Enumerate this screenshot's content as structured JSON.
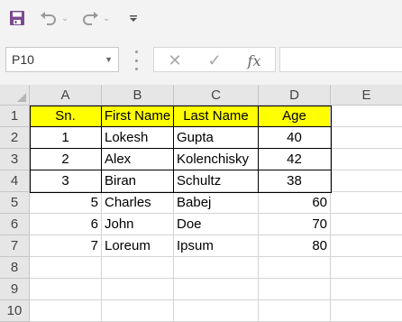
{
  "name_box": {
    "value": "P10"
  },
  "formula_bar": {
    "value": ""
  },
  "columns": [
    "A",
    "B",
    "C",
    "D",
    "E"
  ],
  "rows": [
    {
      "num": "1",
      "cells": [
        "Sn.",
        "First Name",
        "Last Name",
        "Age",
        ""
      ]
    },
    {
      "num": "2",
      "cells": [
        "1",
        "Lokesh",
        "Gupta",
        "40",
        ""
      ]
    },
    {
      "num": "3",
      "cells": [
        "2",
        "Alex",
        "Kolenchisky",
        "42",
        ""
      ]
    },
    {
      "num": "4",
      "cells": [
        "3",
        "Biran",
        "Schultz",
        "38",
        ""
      ]
    },
    {
      "num": "5",
      "cells": [
        "5",
        "Charles",
        "Babej",
        "60",
        ""
      ]
    },
    {
      "num": "6",
      "cells": [
        "6",
        "John",
        "Doe",
        "70",
        ""
      ]
    },
    {
      "num": "7",
      "cells": [
        "7",
        "Loreum",
        "Ipsum",
        "80",
        ""
      ]
    },
    {
      "num": "8",
      "cells": [
        "",
        "",
        "",
        "",
        ""
      ]
    },
    {
      "num": "9",
      "cells": [
        "",
        "",
        "",
        "",
        ""
      ]
    },
    {
      "num": "10",
      "cells": [
        "",
        "",
        "",
        "",
        ""
      ]
    }
  ],
  "icons": [
    "save-icon",
    "undo-icon",
    "redo-icon",
    "customize-qat-icon",
    "cancel-icon",
    "enter-icon",
    "insert-function-icon"
  ],
  "colors": {
    "header_fill": "#ffff00",
    "save_icon": "#7b4a8e"
  }
}
